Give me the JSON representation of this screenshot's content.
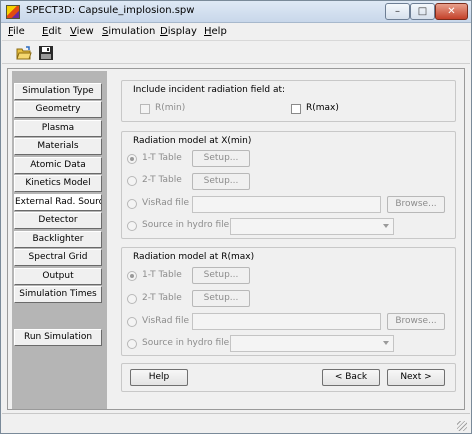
{
  "window": {
    "title": "SPECT3D:  Capsule_implosion.spw"
  },
  "menu": [
    "File",
    "Edit",
    "View",
    "Simulation",
    "Display",
    "Help"
  ],
  "menu_underline": [
    "F",
    "E",
    "V",
    "S",
    "D",
    "H"
  ],
  "toolbar": {
    "open_icon": "open-folder-icon",
    "save_icon": "floppy-save-icon"
  },
  "sidebar": {
    "items": [
      "Simulation Type",
      "Geometry",
      "Plasma",
      "Materials",
      "Atomic Data",
      "Kinetics Model",
      "External Rad. Source",
      "Detector",
      "Backlighter",
      "Spectral Grid",
      "Output",
      "Simulation Times"
    ],
    "active_index": 6,
    "run_button": "Run Simulation"
  },
  "incident": {
    "title": "Include incident radiation field at:",
    "rmin_label": "R(min)",
    "rmax_label": "R(max)"
  },
  "xmin": {
    "title": "Radiation model at X(min)",
    "opt1": "1-T Table",
    "opt2": "2-T Table",
    "opt3": "VisRad file",
    "opt4": "Source in hydro file:",
    "setup": "Setup...",
    "browse": "Browse..."
  },
  "rmax": {
    "title": "Radiation model at R(max)",
    "opt1": "1-T Table",
    "opt2": "2-T Table",
    "opt3": "VisRad file",
    "opt4": "Source in hydro file:",
    "setup": "Setup...",
    "browse": "Browse..."
  },
  "nav": {
    "help": "Help",
    "back": "< Back",
    "next": "Next >"
  }
}
